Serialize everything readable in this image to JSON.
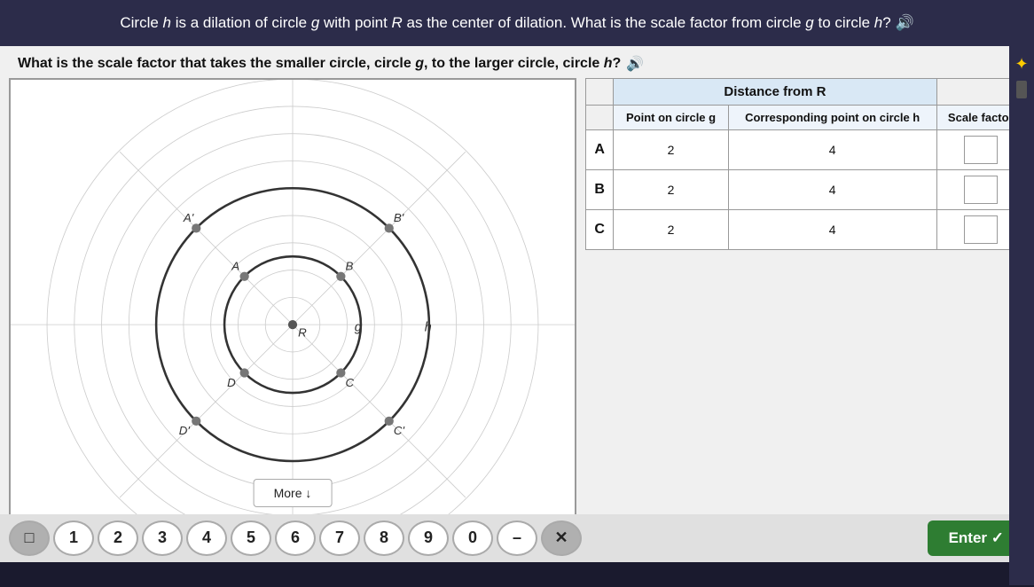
{
  "top_banner": {
    "text": "Circle h is a dilation of circle g with point R as the center of dilation. What is the scale factor from circle g to circle h?",
    "speaker_icon": "🔊"
  },
  "question": {
    "text": "What is the scale factor that takes the smaller circle, circle g, to the larger circle, circle h?",
    "speaker_icon": "🔊"
  },
  "table": {
    "header_distance": "Distance from R",
    "col1_header": "Point on circle g",
    "col2_header": "Corresponding point on circle h",
    "col3_header": "Scale factor",
    "rows": [
      {
        "point": "A",
        "dist_g": "2",
        "dist_h": "4"
      },
      {
        "point": "B",
        "dist_g": "2",
        "dist_h": "4"
      },
      {
        "point": "C",
        "dist_g": "2",
        "dist_h": "4"
      }
    ]
  },
  "more_button": "More ↓",
  "bottom_buttons": {
    "numbers": [
      "□",
      "1",
      "2",
      "3",
      "4",
      "5",
      "6",
      "7",
      "8",
      "9",
      "0",
      "–",
      "✕"
    ],
    "enter": "Enter ✓"
  }
}
